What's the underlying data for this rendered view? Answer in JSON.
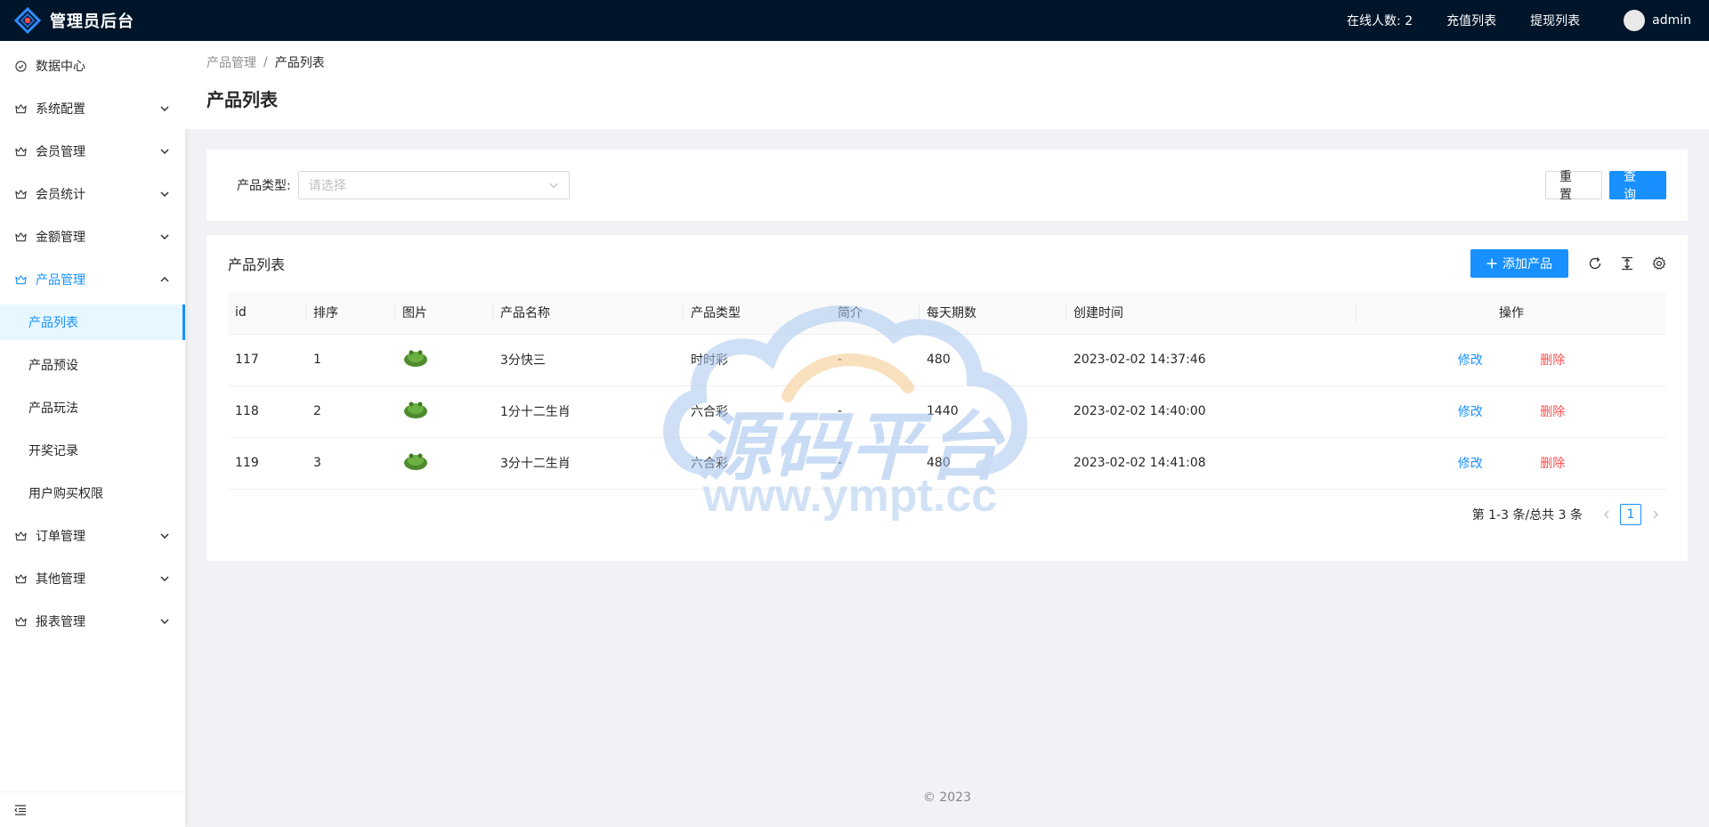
{
  "header": {
    "title": "管理员后台",
    "online_label": "在线人数: 2",
    "recharge_link": "充值列表",
    "withdraw_link": "提现列表",
    "username": "admin"
  },
  "sidebar": {
    "items": [
      {
        "label": "数据中心"
      },
      {
        "label": "系统配置"
      },
      {
        "label": "会员管理"
      },
      {
        "label": "会员统计"
      },
      {
        "label": "金额管理"
      },
      {
        "label": "产品管理"
      },
      {
        "label": "订单管理"
      },
      {
        "label": "其他管理"
      },
      {
        "label": "报表管理"
      }
    ],
    "sub_items": [
      {
        "label": "产品列表"
      },
      {
        "label": "产品预设"
      },
      {
        "label": "产品玩法"
      },
      {
        "label": "开奖记录"
      },
      {
        "label": "用户购买权限"
      }
    ]
  },
  "breadcrumb": {
    "parent": "产品管理",
    "separator": "/",
    "current": "产品列表"
  },
  "page": {
    "title": "产品列表"
  },
  "search": {
    "label": "产品类型:",
    "placeholder": "请选择",
    "reset_label": "重置",
    "query_label": "查询"
  },
  "table": {
    "title": "产品列表",
    "add_label": "添加产品",
    "columns": [
      "id",
      "排序",
      "图片",
      "产品名称",
      "产品类型",
      "简介",
      "每天期数",
      "创建时间",
      "操作"
    ],
    "rows": [
      {
        "id": "117",
        "sort": "1",
        "name": "3分快三",
        "type": "时时彩",
        "intro": "-",
        "periods": "480",
        "created": "2023-02-02 14:37:46"
      },
      {
        "id": "118",
        "sort": "2",
        "name": "1分十二生肖",
        "type": "六合彩",
        "intro": "-",
        "periods": "1440",
        "created": "2023-02-02 14:40:00"
      },
      {
        "id": "119",
        "sort": "3",
        "name": "3分十二生肖",
        "type": "六合彩",
        "intro": "-",
        "periods": "480",
        "created": "2023-02-02 14:41:08"
      }
    ],
    "edit_label": "修改",
    "delete_label": "删除"
  },
  "pagination": {
    "total_text": "第 1-3 条/总共 3 条",
    "current_page": "1"
  },
  "watermark": {
    "text": "源码平台",
    "url": "www.ympt.cc"
  },
  "footer": {
    "copyright": "© 2023"
  },
  "colors": {
    "header_bg": "#001529",
    "primary": "#1890ff",
    "danger": "#ff4d4f"
  }
}
